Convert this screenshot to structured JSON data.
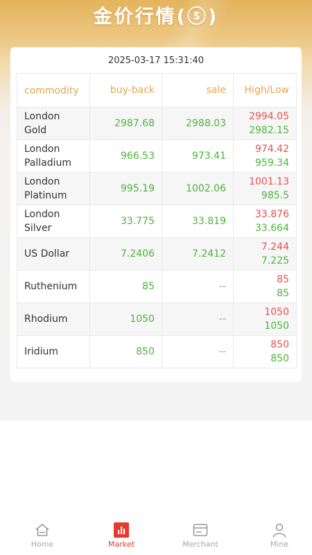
{
  "header": {
    "title": "金价行情(ⓢ)"
  },
  "market": {
    "timestamp": "2025-03-17 15:31:40",
    "columns": [
      "commodity",
      "buy-back",
      "sale",
      "High/Low"
    ],
    "rows": [
      {
        "name": "London Gold",
        "buyback": "2987.68",
        "sale": "2988.03",
        "high": "2994.05",
        "low": "2982.15"
      },
      {
        "name": "London Palladium",
        "buyback": "966.53",
        "sale": "973.41",
        "high": "974.42",
        "low": "959.34"
      },
      {
        "name": "London Platinum",
        "buyback": "995.19",
        "sale": "1002.06",
        "high": "1001.13",
        "low": "985.5"
      },
      {
        "name": "London Silver",
        "buyback": "33.775",
        "sale": "33.819",
        "high": "33.876",
        "low": "33.664"
      },
      {
        "name": "US Dollar",
        "buyback": "7.2406",
        "sale": "7.2412",
        "high": "7.244",
        "low": "7.225"
      },
      {
        "name": "Ruthenium",
        "buyback": "85",
        "sale": "--",
        "high": "85",
        "low": "85"
      },
      {
        "name": "Rhodium",
        "buyback": "1050",
        "sale": "--",
        "high": "1050",
        "low": "1050"
      },
      {
        "name": "Iridium",
        "buyback": "850",
        "sale": "--",
        "high": "850",
        "low": "850"
      }
    ]
  },
  "tabbar": {
    "tabs": [
      {
        "label": "Home",
        "icon": "home-icon"
      },
      {
        "label": "Market",
        "icon": "bar-chart-icon",
        "active": true
      },
      {
        "label": "Merchant",
        "icon": "card-icon"
      },
      {
        "label": "Mine",
        "icon": "user-icon"
      }
    ]
  },
  "colors": {
    "accent": "#e0a84a",
    "header_gradient_top": "#e4b45c",
    "up_green": "#4cb33a",
    "high_red": "#e45050",
    "active_tab": "#e43b2c",
    "inactive_tab": "#a8a8a8"
  }
}
